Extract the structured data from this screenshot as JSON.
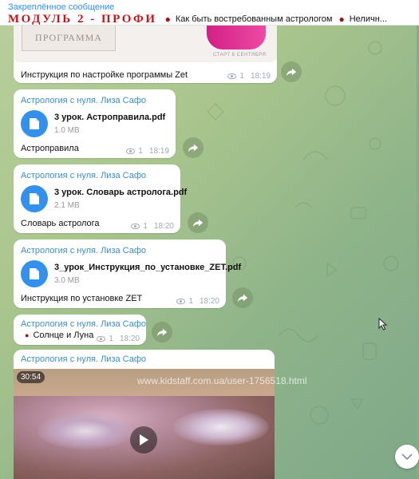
{
  "pinned": {
    "title": "Закреплённое сообщение",
    "brand": "МОДУЛЬ 2 - ПРОФИ",
    "items": [
      "Как быть востребованным астрологом",
      "Неличн..."
    ],
    "dot_color": "#a01515"
  },
  "promo_image": {
    "button_text": "ПРОГРАММА",
    "start_text": "СТАРТ 6 СЕНТЯБРЯ"
  },
  "messages": [
    {
      "caption": "Инструкция по настройке программы Zet",
      "views": "1",
      "time": "18:19"
    },
    {
      "sender": "Астрология с нуля. Лиза Сафо",
      "file_name": "3 урок. Астроправила.pdf",
      "file_size": "1.0 MB",
      "caption": "Астроправила",
      "views": "1",
      "time": "18:19"
    },
    {
      "sender": "Астрология с нуля. Лиза Сафо",
      "file_name": "3 урок. Словарь астролога.pdf",
      "file_size": "2.1 MB",
      "caption": "Словарь астролога",
      "views": "1",
      "time": "18:20"
    },
    {
      "sender": "Астрология с нуля. Лиза Сафо",
      "file_name": "3_урок_Инструкция_по_установке_ZET.pdf",
      "file_size": "3.0 MB",
      "caption": "Инструкция по установке ZET",
      "views": "1",
      "time": "18:20"
    },
    {
      "sender": "Астрология с нуля. Лиза Сафо",
      "caption": "Солнце и Луна",
      "views": "1",
      "time": "18:20"
    },
    {
      "sender": "Астрология с нуля. Лиза Сафо",
      "duration": "30:54"
    }
  ],
  "watermark": "www.kidstaff.com.ua/user-1756518.html",
  "colors": {
    "accent": "#3390ec",
    "brand_red": "#c0161b",
    "sender": "#3a8ec3"
  }
}
